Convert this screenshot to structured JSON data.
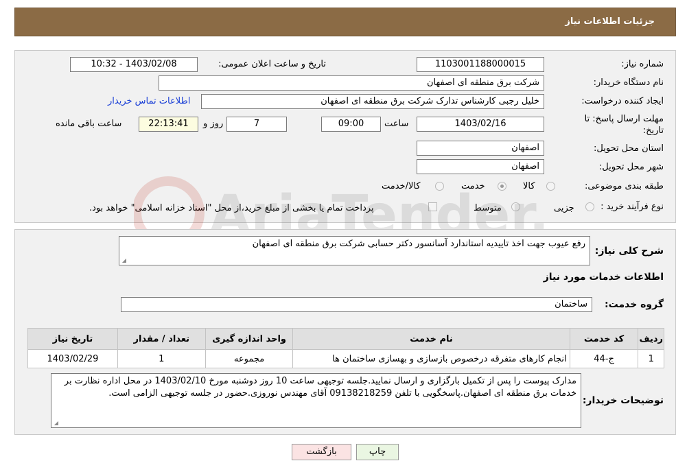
{
  "header": {
    "title": "جزئیات اطلاعات نیاز"
  },
  "form": {
    "need_number": {
      "label": "شماره نیاز:",
      "value": "1103001188000015"
    },
    "announce_datetime": {
      "label": "تاریخ و ساعت اعلان عمومی:",
      "value": "1403/02/08 - 10:32"
    },
    "buyer_org": {
      "label": "نام دستگاه خريدار:",
      "value": "شرکت برق منطقه ای اصفهان"
    },
    "requester": {
      "label": "ايجاد کننده درخواست:",
      "value": "خلیل رجبی کارشناس تدارک شرکت برق منطقه ای اصفهان"
    },
    "buyer_contact_link": "اطلاعات تماس خریدار",
    "deadline": {
      "label_line1": "مهلت ارسال پاسخ: تا",
      "label_line2": "تاریخ:",
      "date": "1403/02/16",
      "time_label": "ساعت",
      "time": "09:00",
      "days": "7",
      "days_label": "روز و",
      "remaining_time": "22:13:41",
      "remaining_label": "ساعت باقی مانده"
    },
    "province": {
      "label": "استان محل تحویل:",
      "value": "اصفهان"
    },
    "city": {
      "label": "شهر محل تحویل:",
      "value": "اصفهان"
    },
    "category": {
      "label": "طبقه بندی موضوعی:",
      "options": [
        {
          "label": "کالا",
          "checked": false
        },
        {
          "label": "خدمت",
          "checked": true
        },
        {
          "label": "کالا/خدمت",
          "checked": false
        }
      ]
    },
    "purchase_process": {
      "label": "نوع فرآیند خرید :",
      "options": [
        {
          "label": "جزیی",
          "checked": false
        },
        {
          "label": "متوسط",
          "checked": false
        }
      ],
      "payment_note": "پرداخت تمام یا بخشی از مبلغ خرید،از محل \"اسناد خزانه اسلامی\" خواهد بود."
    }
  },
  "summary": {
    "label": "شرح کلی نیاز:",
    "value": "رفع عیوب جهت اخذ تاییدیه استاندارد آسانسور دکتر حسابی شرکت برق منطقه ای اصفهان"
  },
  "services_section": {
    "title": "اطلاعات خدمات مورد نیاز",
    "service_group_label": "گروه خدمت:",
    "service_group_value": "ساختمان",
    "table": {
      "headers": [
        "ردیف",
        "کد خدمت",
        "نام خدمت",
        "واحد اندازه گیری",
        "تعداد / مقدار",
        "تاریخ نیاز"
      ],
      "rows": [
        [
          "1",
          "ج-44",
          "انجام کارهای متفرقه درخصوص بازسازی و بهسازی ساختمان ها",
          "مجموعه",
          "1",
          "1403/02/29"
        ]
      ]
    }
  },
  "buyer_notes": {
    "label": "توضیحات خریدار:",
    "value": "مدارک پیوست را پس از تکمیل بارگزاری و ارسال نمایید.جلسه توجیهی ساعت 10 روز دوشنبه مورخ 1403/02/10 در محل اداره نظارت بر خدمات برق منطقه ای اصفهان.پاسخگویی با تلفن 09138218259 آقای مهندس نوروزی.حضور در جلسه توجیهی الزامی است."
  },
  "buttons": {
    "print": "چاپ",
    "back": "بازگشت"
  },
  "watermark": {
    "text": "AriaTender.net"
  },
  "colors": {
    "header_bg": "#8b6b45",
    "link": "#1a3fd6",
    "print_btn": "#eaf6e2",
    "back_btn": "#fbe3e3"
  }
}
